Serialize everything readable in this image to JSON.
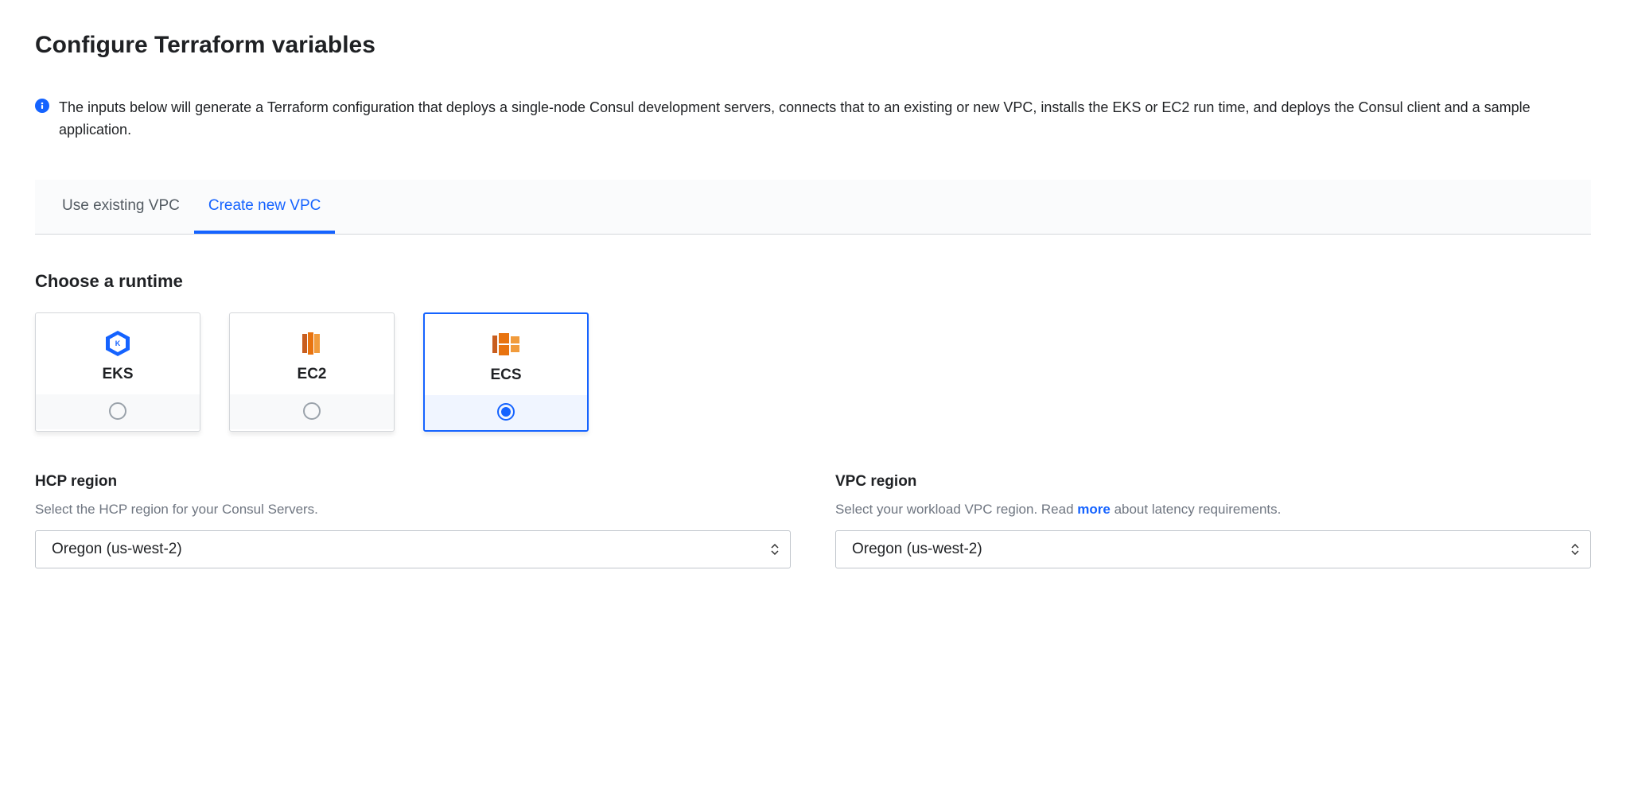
{
  "title": "Configure Terraform variables",
  "info_text": "The inputs below will generate a Terraform configuration that deploys a single-node Consul development servers, connects that to an existing or new VPC, installs the EKS or EC2 run time, and deploys the Consul client and a sample application.",
  "tabs": {
    "existing": "Use existing VPC",
    "create": "Create new VPC"
  },
  "runtime": {
    "heading": "Choose a runtime",
    "options": {
      "eks": "EKS",
      "ec2": "EC2",
      "ecs": "ECS"
    }
  },
  "hcp_region": {
    "label": "HCP region",
    "help": "Select the HCP region for your Consul Servers.",
    "value": "Oregon (us-west-2)"
  },
  "vpc_region": {
    "label": "VPC region",
    "help_before": "Select your workload VPC region. Read ",
    "more": "more",
    "help_after": " about latency requirements.",
    "value": "Oregon (us-west-2)"
  }
}
